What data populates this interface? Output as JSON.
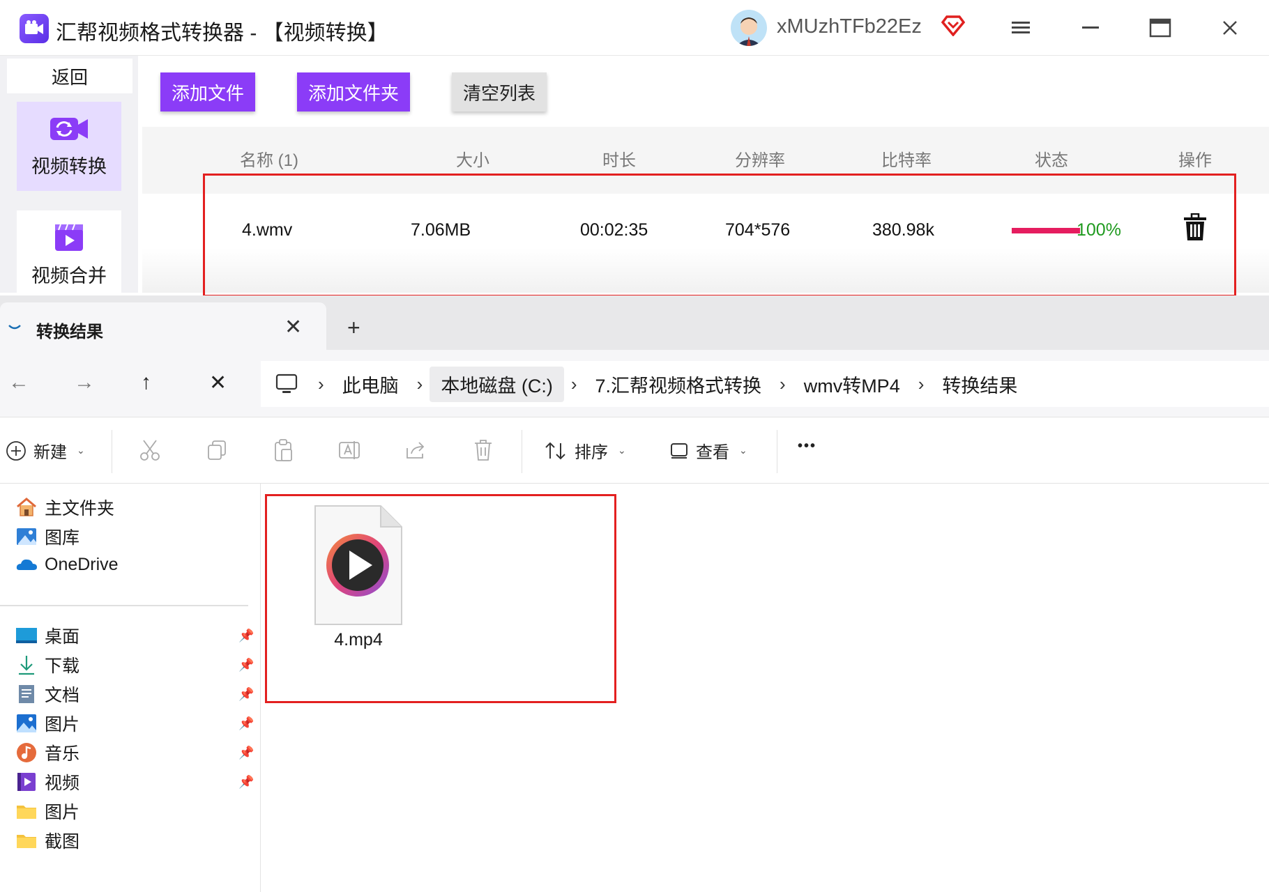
{
  "converter": {
    "app_title": "汇帮视频格式转换器  - 【视频转换】",
    "username": "xMUzhTFb22Ez",
    "back_label": "返回",
    "nav": [
      {
        "label": "视频转换",
        "icon": "video-convert-icon",
        "active": true
      },
      {
        "label": "视频合并",
        "icon": "video-merge-icon",
        "active": false
      }
    ],
    "buttons": {
      "add_file": "添加文件",
      "add_folder": "添加文件夹",
      "clear_list": "清空列表"
    },
    "columns": [
      "名称 (1)",
      "大小",
      "时长",
      "分辨率",
      "比特率",
      "状态",
      "操作"
    ],
    "files": [
      {
        "name": "4.wmv",
        "size": "7.06MB",
        "duration": "00:02:35",
        "resolution": "704*576",
        "bitrate": "380.98k",
        "progress": 1.0,
        "progress_text": "100%"
      }
    ],
    "colors": {
      "accent": "#8b3cf7",
      "progress": "#e51d5f",
      "status_text": "#1f9a1f",
      "highlight_box": "#e32020"
    }
  },
  "explorer": {
    "tab_title": "转换结果",
    "tab_add": "+",
    "nav_buttons": {
      "back": "←",
      "forward": "→",
      "up": "↑",
      "close": "✕"
    },
    "breadcrumb": [
      "此电脑",
      "本地磁盘 (C:)",
      "7.汇帮视频格式转换",
      "wmv转MP4",
      "转换结果"
    ],
    "toolbar": {
      "new": "新建",
      "sort": "排序",
      "view": "查看",
      "more": "•••"
    },
    "sidebar_top": [
      {
        "label": "主文件夹",
        "icon": "home-icon"
      },
      {
        "label": "图库",
        "icon": "gallery-icon"
      },
      {
        "label": "OneDrive",
        "icon": "onedrive-icon"
      }
    ],
    "sidebar_pinned": [
      {
        "label": "桌面",
        "icon": "desktop-icon"
      },
      {
        "label": "下载",
        "icon": "download-icon"
      },
      {
        "label": "文档",
        "icon": "document-icon"
      },
      {
        "label": "图片",
        "icon": "pictures-icon"
      },
      {
        "label": "音乐",
        "icon": "music-icon"
      },
      {
        "label": "视频",
        "icon": "videos-icon"
      }
    ],
    "sidebar_folders": [
      {
        "label": "图片",
        "icon": "folder-icon"
      },
      {
        "label": "截图",
        "icon": "folder-icon"
      }
    ],
    "files": [
      {
        "name": "4.mp4",
        "icon": "video-file-icon"
      }
    ]
  }
}
